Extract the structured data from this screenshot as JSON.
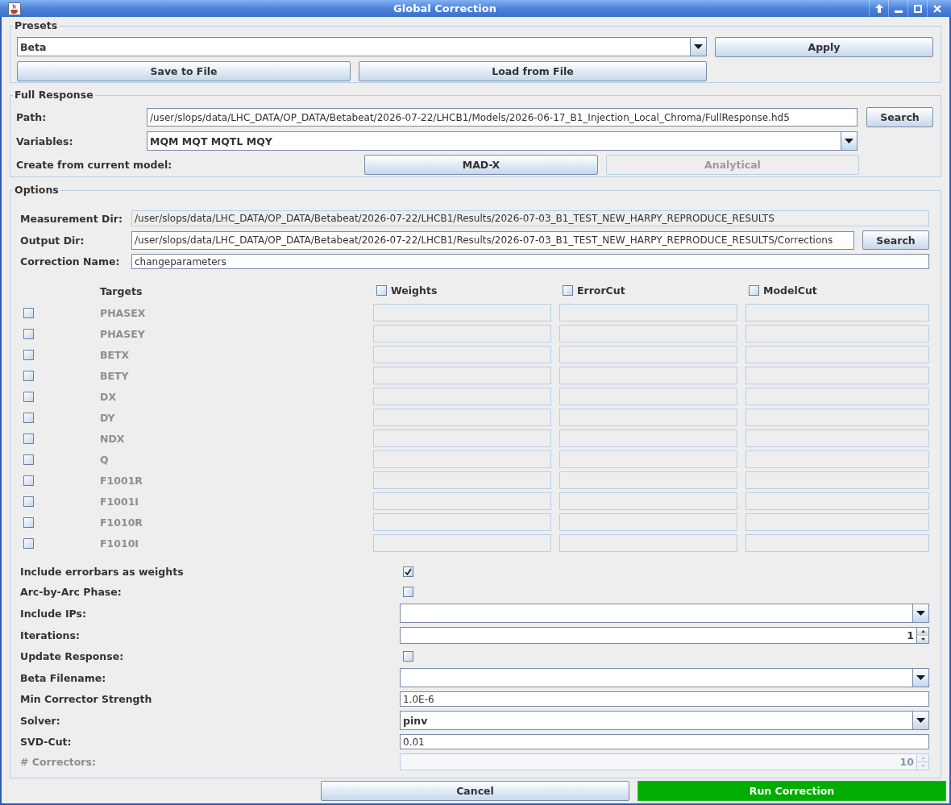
{
  "window": {
    "title": "Global Correction"
  },
  "presets": {
    "title": "Presets",
    "selected_preset": "Beta",
    "apply_button": "Apply",
    "save_button": "Save to File",
    "load_button": "Load from File"
  },
  "full_response": {
    "title": "Full Response",
    "path": {
      "label": "Path:",
      "value": "/user/slops/data/LHC_DATA/OP_DATA/Betabeat/2026-07-22/LHCB1/Models/2026-06-17_B1_Injection_Local_Chroma/FullResponse.hd5",
      "button": "Search"
    },
    "variables": {
      "label": "Variables:",
      "value": "MQM MQT MQTL MQY"
    },
    "create": {
      "label": "Create from current model:",
      "buttons": [
        {
          "label": "MAD-X",
          "disabled": false
        },
        {
          "label": "Analytical",
          "disabled": true
        }
      ]
    }
  },
  "options": {
    "title": "Options",
    "fields": [
      {
        "label": "Measurement Dir:",
        "value": "/user/slops/data/LHC_DATA/OP_DATA/Betabeat/2026-07-22/LHCB1/Results/2026-07-03_B1_TEST_NEW_HARPY_REPRODUCE_RESULTS",
        "editable": false
      },
      {
        "label": "Output Dir:",
        "value": "/user/slops/data/LHC_DATA/OP_DATA/Betabeat/2026-07-22/LHCB1/Results/2026-07-03_B1_TEST_NEW_HARPY_REPRODUCE_RESULTS/Corrections",
        "editable": true,
        "button": "Search"
      },
      {
        "label": "Correction Name:",
        "value": "changeparameters",
        "editable": true
      }
    ],
    "targets": {
      "header": "Targets",
      "columns": [
        {
          "label": "Weights",
          "checked": false
        },
        {
          "label": "ErrorCut",
          "checked": false
        },
        {
          "label": "ModelCut",
          "checked": false
        }
      ],
      "rows": [
        {
          "name": "PHASEX",
          "checked": false,
          "disabled": true
        },
        {
          "name": "PHASEY",
          "checked": false,
          "disabled": true
        },
        {
          "name": "BETX",
          "checked": false,
          "disabled": true
        },
        {
          "name": "BETY",
          "checked": false,
          "disabled": true
        },
        {
          "name": "DX",
          "checked": false,
          "disabled": true
        },
        {
          "name": "DY",
          "checked": false,
          "disabled": true
        },
        {
          "name": "NDX",
          "checked": false,
          "disabled": true
        },
        {
          "name": "Q",
          "checked": false,
          "disabled": true
        },
        {
          "name": "F1001R",
          "checked": false,
          "disabled": true
        },
        {
          "name": "F1001I",
          "checked": false,
          "disabled": true
        },
        {
          "name": "F1010R",
          "checked": false,
          "disabled": true
        },
        {
          "name": "F1010I",
          "checked": false,
          "disabled": true
        }
      ]
    },
    "settings": [
      {
        "kind": "checkbox",
        "label": "Include errorbars as weights",
        "checked": true,
        "disabled": false
      },
      {
        "kind": "checkbox",
        "label": "Arc-by-Arc Phase:",
        "checked": false,
        "disabled": false
      },
      {
        "kind": "combo",
        "label": "Include IPs:",
        "disabled": false
      },
      {
        "kind": "spinner",
        "label": "Iterations:",
        "value": "1",
        "disabled": false
      },
      {
        "kind": "checkbox",
        "label": "Update Response:",
        "checked": false,
        "disabled": false
      },
      {
        "kind": "combo",
        "label": "Beta Filename:",
        "disabled": false
      },
      {
        "kind": "text",
        "label": "Min Corrector Strength",
        "value": "1.0E-6",
        "disabled": false
      },
      {
        "kind": "combo",
        "label": "Solver:",
        "value": "pinv",
        "disabled": false
      },
      {
        "kind": "text",
        "label": "SVD-Cut:",
        "value": "0.01",
        "disabled": false
      },
      {
        "kind": "spinner",
        "label": "# Correctors:",
        "value": "10",
        "disabled": true
      }
    ]
  },
  "footer": {
    "buttons": [
      {
        "label": "Cancel",
        "kind": "secondary"
      },
      {
        "label": "Run Correction",
        "kind": "primary"
      }
    ]
  }
}
